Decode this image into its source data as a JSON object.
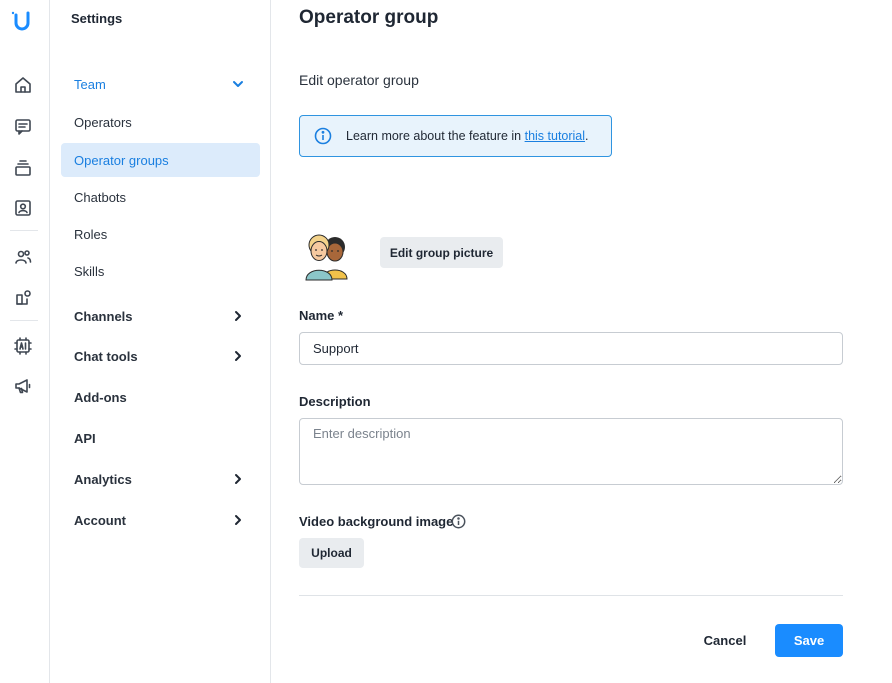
{
  "rail": {
    "icons": [
      "logo-icon",
      "home-icon",
      "chat-icon",
      "inbox-stack-icon",
      "contacts-icon",
      "team-icon",
      "integrations-icon",
      "ai-chip-icon",
      "megaphone-icon"
    ]
  },
  "sidebar": {
    "title": "Settings",
    "items": [
      {
        "label": "Team",
        "expandable": true,
        "expanded": true
      },
      {
        "label": "Operators"
      },
      {
        "label": "Operator groups",
        "active": true
      },
      {
        "label": "Chatbots"
      },
      {
        "label": "Roles"
      },
      {
        "label": "Skills"
      },
      {
        "label": "Channels",
        "expandable": true
      },
      {
        "label": "Chat tools",
        "expandable": true
      },
      {
        "label": "Add-ons"
      },
      {
        "label": "API"
      },
      {
        "label": "Analytics",
        "expandable": true
      },
      {
        "label": "Account",
        "expandable": true
      }
    ]
  },
  "main": {
    "title": "Operator group",
    "subtitle": "Edit operator group",
    "info": {
      "text": "Learn more about the feature in ",
      "link": "this tutorial",
      "suffix": "."
    },
    "edit_picture_label": "Edit group picture",
    "name_label": "Name *",
    "name_value": "Support",
    "description_label": "Description",
    "description_placeholder": "Enter description",
    "video_bg_label": "Video background image",
    "upload_label": "Upload",
    "cancel_label": "Cancel",
    "save_label": "Save"
  },
  "colors": {
    "accent": "#1a8cff",
    "active_bg": "#dcebfb",
    "info_bg": "#e8f3fc"
  }
}
